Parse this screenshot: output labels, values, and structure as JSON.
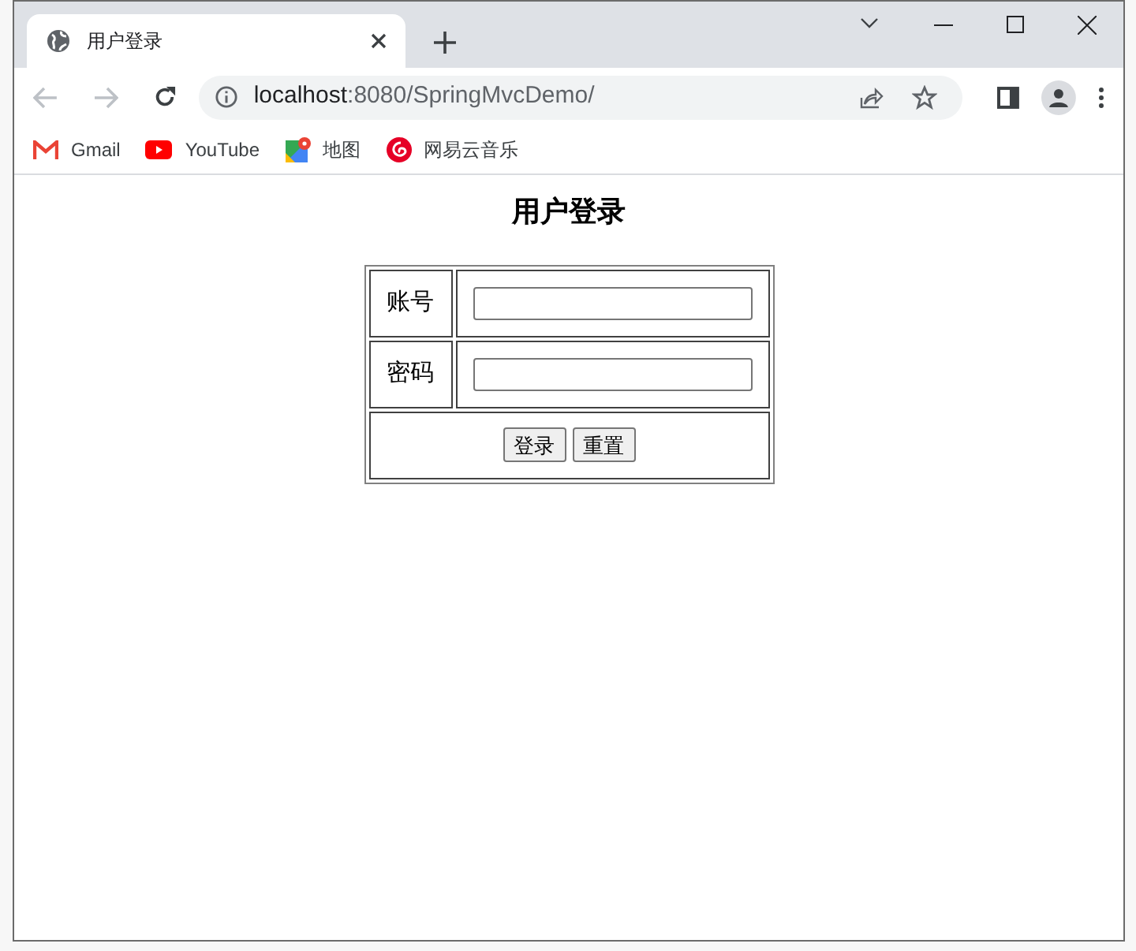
{
  "tab": {
    "title": "用户登录",
    "selected": true
  },
  "address_bar": {
    "host": "localhost",
    "path": ":8080/SpringMvcDemo/"
  },
  "bookmarks": [
    {
      "label": "Gmail",
      "kind": "gmail"
    },
    {
      "label": "YouTube",
      "kind": "youtube"
    },
    {
      "label": "地图",
      "kind": "maps"
    },
    {
      "label": "网易云音乐",
      "kind": "music"
    }
  ],
  "page": {
    "heading": "用户登录",
    "fields": [
      {
        "label": "账号"
      },
      {
        "label": "密码"
      }
    ],
    "buttons": [
      "登录",
      "重置"
    ]
  }
}
